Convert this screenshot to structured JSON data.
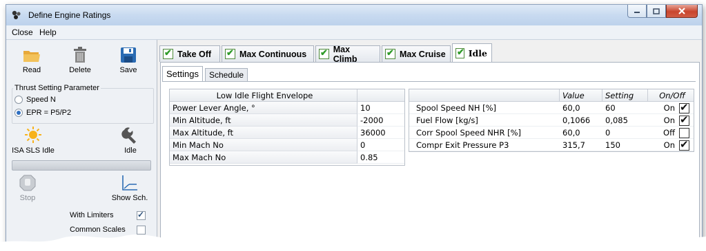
{
  "window": {
    "title": "Define Engine Ratings"
  },
  "menu": [
    "Close",
    "Help"
  ],
  "toolbar": {
    "read": "Read",
    "delete": "Delete",
    "save": "Save"
  },
  "thrust_param": {
    "title": "Thrust Setting Parameter",
    "options": [
      "Speed N",
      "EPR = P5/P2"
    ],
    "selected": 1
  },
  "actions": {
    "isa": "ISA SLS Idle",
    "idle": "Idle",
    "stop": "Stop",
    "show_sch": "Show Sch."
  },
  "options": {
    "with_limiters": {
      "label": "With Limiters",
      "checked": true
    },
    "common_scales": {
      "label": "Common Scales",
      "checked": false
    }
  },
  "tabs": [
    {
      "label": "Take Off",
      "checked": true,
      "active": false
    },
    {
      "label": "Max Continuous",
      "checked": true,
      "active": false
    },
    {
      "label": "Max Climb",
      "checked": true,
      "active": false
    },
    {
      "label": "Max Cruise",
      "checked": true,
      "active": false
    },
    {
      "label": "Idle",
      "checked": true,
      "active": true
    }
  ],
  "subtabs": [
    {
      "label": "Settings",
      "active": true
    },
    {
      "label": "Schedule",
      "active": false
    }
  ],
  "envelope": {
    "header": "Low Idle Flight Envelope",
    "rows": [
      {
        "label": "Power Lever Angle, °",
        "value": "10"
      },
      {
        "label": "Min Altitude, ft",
        "value": "-2000"
      },
      {
        "label": "Max Altitude, ft",
        "value": "36000"
      },
      {
        "label": "Min Mach No",
        "value": "0"
      },
      {
        "label": "Max Mach No",
        "value": "0.85"
      }
    ]
  },
  "limits": {
    "headers": {
      "value": "Value",
      "setting": "Setting",
      "onoff": "On/Off"
    },
    "rows": [
      {
        "label": "Spool Speed NH [%]",
        "value": "60,0",
        "setting": "60",
        "state": "On",
        "checked": true
      },
      {
        "label": "Fuel Flow [kg/s]",
        "value": "0,1066",
        "setting": "0,085",
        "state": "On",
        "checked": true
      },
      {
        "label": "Corr Spool Speed NHR [%]",
        "value": "60,0",
        "setting": "0",
        "state": "Off",
        "checked": false
      },
      {
        "label": "Compr Exit Pressure P3",
        "value": "315,7",
        "setting": "150",
        "state": "On",
        "checked": true
      }
    ]
  }
}
